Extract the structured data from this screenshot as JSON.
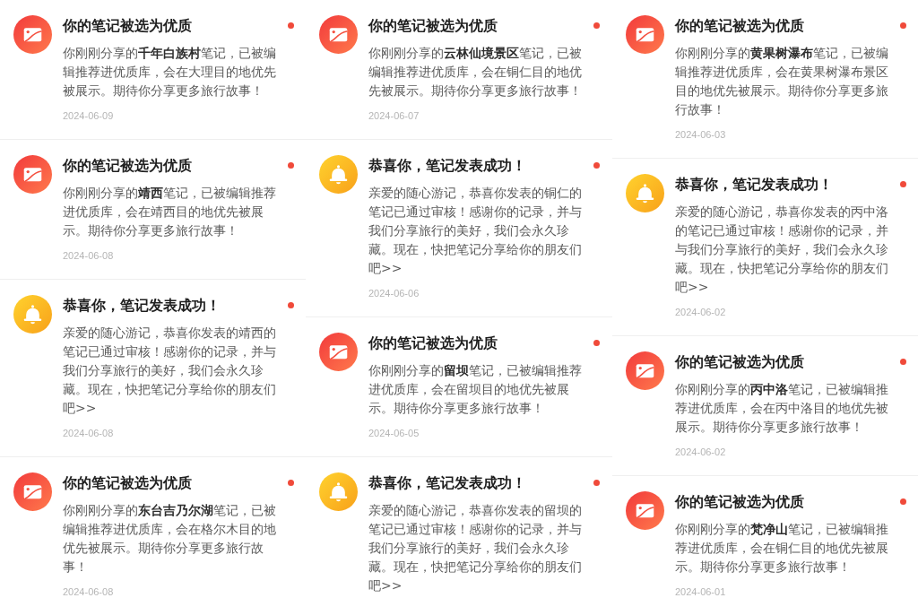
{
  "columns": [
    {
      "items": [
        {
          "kind": "featured",
          "title": "你的笔记被选为优质",
          "message": "你刚刚分享的**千年白族村**笔记，已被编辑推荐进优质库，会在大理目的地优先被展示。期待你分享更多旅行故事！",
          "date": "2024-06-09",
          "unread": true
        },
        {
          "kind": "featured",
          "title": "你的笔记被选为优质",
          "message": "你刚刚分享的**靖西**笔记，已被编辑推荐进优质库，会在靖西目的地优先被展示。期待你分享更多旅行故事！",
          "date": "2024-06-08",
          "unread": true
        },
        {
          "kind": "published",
          "title": "恭喜你，笔记发表成功！",
          "message": "亲爱的随心游记，恭喜你发表的靖西的笔记已通过审核！感谢你的记录，并与我们分享旅行的美好，我们会永久珍藏。现在，快把笔记分享给你的朋友们吧>>",
          "date": "2024-06-08",
          "unread": true
        },
        {
          "kind": "featured",
          "title": "你的笔记被选为优质",
          "message": "你刚刚分享的**东台吉乃尔湖**笔记，已被编辑推荐进优质库，会在格尔木目的地优先被展示。期待你分享更多旅行故事！",
          "date": "2024-06-08",
          "unread": true
        }
      ]
    },
    {
      "items": [
        {
          "kind": "featured",
          "title": "你的笔记被选为优质",
          "message": "你刚刚分享的**云林仙境景区**笔记，已被编辑推荐进优质库，会在铜仁目的地优先被展示。期待你分享更多旅行故事！",
          "date": "2024-06-07",
          "unread": true
        },
        {
          "kind": "published",
          "title": "恭喜你，笔记发表成功！",
          "message": "亲爱的随心游记，恭喜你发表的铜仁的笔记已通过审核！感谢你的记录，并与我们分享旅行的美好，我们会永久珍藏。现在，快把笔记分享给你的朋友们吧>>",
          "date": "2024-06-06",
          "unread": true
        },
        {
          "kind": "featured",
          "title": "你的笔记被选为优质",
          "message": "你刚刚分享的**留坝**笔记，已被编辑推荐进优质库，会在留坝目的地优先被展示。期待你分享更多旅行故事！",
          "date": "2024-06-05",
          "unread": true
        },
        {
          "kind": "published",
          "title": "恭喜你，笔记发表成功！",
          "message": "亲爱的随心游记，恭喜你发表的留坝的笔记已通过审核！感谢你的记录，并与我们分享旅行的美好，我们会永久珍藏。现在，快把笔记分享给你的朋友们吧>>",
          "unread": true
        }
      ]
    },
    {
      "items": [
        {
          "kind": "featured",
          "title": "你的笔记被选为优质",
          "message": "你刚刚分享的**黄果树瀑布**笔记，已被编辑推荐进优质库，会在黄果树瀑布景区目的地优先被展示。期待你分享更多旅行故事！",
          "date": "2024-06-03",
          "unread": true
        },
        {
          "kind": "published",
          "title": "恭喜你，笔记发表成功！",
          "message": "亲爱的随心游记，恭喜你发表的丙中洛的笔记已通过审核！感谢你的记录，并与我们分享旅行的美好，我们会永久珍藏。现在，快把笔记分享给你的朋友们吧>>",
          "date": "2024-06-02",
          "unread": true
        },
        {
          "kind": "featured",
          "title": "你的笔记被选为优质",
          "message": "你刚刚分享的**丙中洛**笔记，已被编辑推荐进优质库，会在丙中洛目的地优先被展示。期待你分享更多旅行故事！",
          "date": "2024-06-02",
          "unread": true
        },
        {
          "kind": "featured",
          "title": "你的笔记被选为优质",
          "message": "你刚刚分享的**梵净山**笔记，已被编辑推荐进优质库，会在铜仁目的地优先被展示。期待你分享更多旅行故事！",
          "date": "2024-06-01",
          "unread": true
        }
      ]
    }
  ]
}
